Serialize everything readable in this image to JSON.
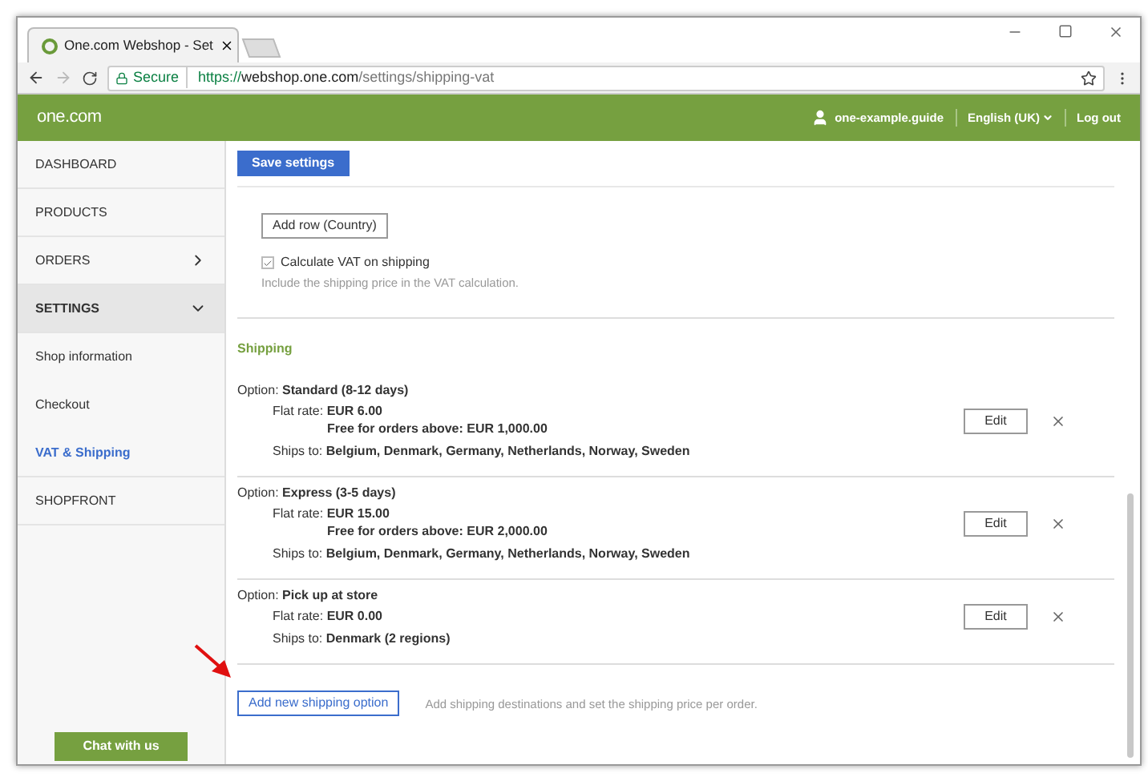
{
  "browser": {
    "tab_title": "One.com Webshop - Set",
    "secure_label": "Secure",
    "url_scheme": "https://",
    "url_host": "webshop.one.com",
    "url_path": "/settings/shipping-vat"
  },
  "header": {
    "logo": "one.com",
    "user": "one-example.guide",
    "language": "English (UK)",
    "logout": "Log out"
  },
  "sidebar": {
    "items": [
      {
        "label": "DASHBOARD",
        "kind": "section",
        "selected": false
      },
      {
        "label": "PRODUCTS",
        "kind": "section",
        "selected": false
      },
      {
        "label": "ORDERS",
        "kind": "section",
        "selected": false,
        "expanded": false
      },
      {
        "label": "SETTINGS",
        "kind": "section",
        "selected": false,
        "expanded": true
      },
      {
        "label": "Shop information",
        "kind": "sub",
        "selected": false
      },
      {
        "label": "Checkout",
        "kind": "sub",
        "selected": false
      },
      {
        "label": "VAT & Shipping",
        "kind": "sub",
        "selected": true
      },
      {
        "label": "SHOPFRONT",
        "kind": "section",
        "selected": false
      }
    ],
    "chat_button": "Chat with us"
  },
  "content": {
    "save_button": "Save settings",
    "add_row_button": "Add row (Country)",
    "vat_checkbox": {
      "label": "Calculate VAT on shipping",
      "checked": true,
      "hint": "Include the shipping price in the VAT calculation."
    },
    "shipping_heading": "Shipping",
    "options": [
      {
        "option_label": "Option:",
        "name": "Standard (8-12 days)",
        "rate_label": "Flat rate:",
        "rate": "EUR 6.00",
        "free": "Free for orders above: EUR 1,000.00",
        "ships_label": "Ships to:",
        "ships_to": "Belgium, Denmark, Germany, Netherlands, Norway, Sweden",
        "edit": "Edit"
      },
      {
        "option_label": "Option:",
        "name": "Express (3-5 days)",
        "rate_label": "Flat rate:",
        "rate": "EUR 15.00",
        "free": "Free for orders above: EUR 2,000.00",
        "ships_label": "Ships to:",
        "ships_to": "Belgium, Denmark, Germany, Netherlands, Norway, Sweden",
        "edit": "Edit"
      },
      {
        "option_label": "Option:",
        "name": "Pick up at store",
        "rate_label": "Flat rate:",
        "rate": "EUR 0.00",
        "ships_label": "Ships to:",
        "ships_to": "Denmark (2 regions)",
        "edit": "Edit"
      }
    ],
    "add_option_button": "Add new shipping option",
    "add_option_hint": "Add shipping destinations and set the shipping price per order."
  }
}
